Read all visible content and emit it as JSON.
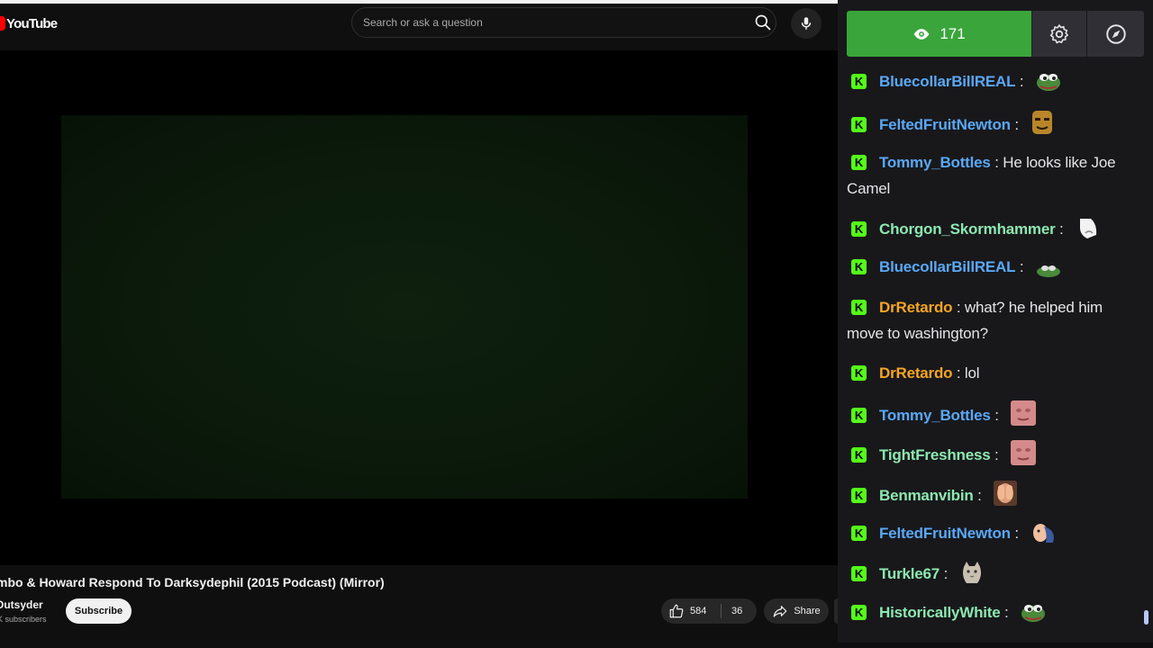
{
  "youtube": {
    "logo_text": "YouTube",
    "search_placeholder": "Search or ask a question",
    "video_title": "mbo & Howard Respond To Darksydephil (2015 Podcast) (Mirror)",
    "channel_name": "Outsyder",
    "subscriber_count": "K subscribers",
    "subscribe_label": "Subscribe",
    "like_count": "584",
    "dislike_count": "36",
    "share_label": "Share"
  },
  "chat": {
    "viewer_count": "171",
    "messages": [
      {
        "user": "BluecollarBillREAL",
        "color": "#5aa8f5",
        "text": "",
        "emote": "pepe-frog-emote"
      },
      {
        "user": "FeltedFruitNewton",
        "color": "#5aa8f5",
        "text": "",
        "emote": "golden-mask-emote"
      },
      {
        "user": "Tommy_Bottles",
        "color": "#5aa8f5",
        "text": "He looks like Joe Camel",
        "emote": ""
      },
      {
        "user": "Chorgon_Skormhammer",
        "color": "#8de8b0",
        "text": "",
        "emote": "white-hand-emote"
      },
      {
        "user": "BluecollarBillREAL",
        "color": "#5aa8f5",
        "text": "",
        "emote": "pepe-small-emote"
      },
      {
        "user": "DrRetardo",
        "color": "#f5a623",
        "text": "what? he helped him move to washington?",
        "emote": ""
      },
      {
        "user": "DrRetardo",
        "color": "#f5a623",
        "text": "lol",
        "emote": ""
      },
      {
        "user": "Tommy_Bottles",
        "color": "#5aa8f5",
        "text": "",
        "emote": "pink-face-emote"
      },
      {
        "user": "TightFreshness",
        "color": "#8de8b0",
        "text": "",
        "emote": "pink-face-emote"
      },
      {
        "user": "Benmanvibin",
        "color": "#8de8b0",
        "text": "",
        "emote": "face-palm-emote"
      },
      {
        "user": "FeltedFruitNewton",
        "color": "#5aa8f5",
        "text": "",
        "emote": "hand-face-emote"
      },
      {
        "user": "Turkle67",
        "color": "#8de8b0",
        "text": "",
        "emote": "cat-emote"
      },
      {
        "user": "HistoricallyWhite",
        "color": "#8de8b0",
        "text": "",
        "emote": "pepe-frog-emote"
      }
    ]
  }
}
